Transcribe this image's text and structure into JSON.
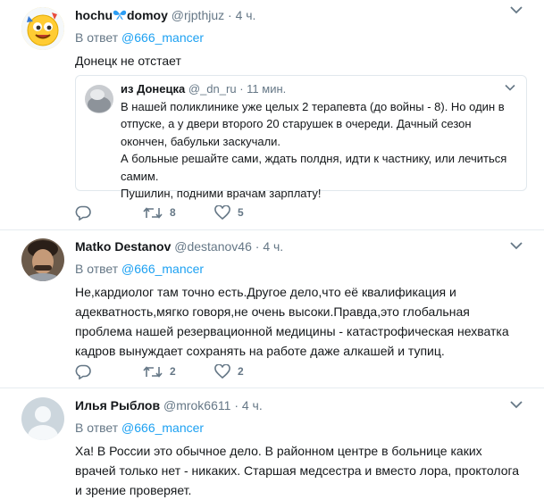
{
  "tweets": [
    {
      "name": "hochu",
      "name_suffix": "domoy",
      "handle": "@rjpthjuz",
      "dot": "·",
      "time": "4 ч.",
      "reply_prefix": "В ответ",
      "reply_mention": "@666_mancer",
      "text": "Донецк не отстает",
      "quote": {
        "name": "из Донецка",
        "handle": "@_dn_ru",
        "dot": "·",
        "time": "11 мин.",
        "lines": [
          "В нашей поликлинике уже целых 2 терапевта (до войны - 8). Но один в отпуске, а у двери второго 20 старушек в очереди. Дачный сезон окончен, бабульки заскучали.",
          "А больные решайте сами, ждать полдня, идти к частнику, или лечиться самим.",
          "Пушилин, подними врачам зарплату!"
        ]
      },
      "actions": {
        "reply": "",
        "retweet": "8",
        "like": "5"
      }
    },
    {
      "name": "Matko Destanov",
      "handle": "@destanov46",
      "dot": "·",
      "time": "4 ч.",
      "reply_prefix": "В ответ",
      "reply_mention": "@666_mancer",
      "text": "Не,кардиолог там точно есть.Другое дело,что её квалификация и адекватность,мягко говоря,не очень высоки.Правда,это глобальная проблема нашей резервационной медицины - катастрофическая нехватка кадров вынуждает сохранять на работе даже алкашей и тупиц.",
      "actions": {
        "reply": "",
        "retweet": "2",
        "like": "2"
      }
    },
    {
      "name": "Илья Рыблов",
      "handle": "@mrok6611",
      "dot": "·",
      "time": "4 ч.",
      "reply_prefix": "В ответ",
      "reply_mention": "@666_mancer",
      "text": "Ха! В России это обычное дело. В районном центре в больнице каких врачей только нет - никаких. Старшая медсестра и вместо лора, проктолога и зрение проверяет."
    }
  ],
  "colors": {
    "link": "#1da1f2",
    "muted": "#657786",
    "text": "#14171a",
    "divider": "#e6ecf0"
  }
}
